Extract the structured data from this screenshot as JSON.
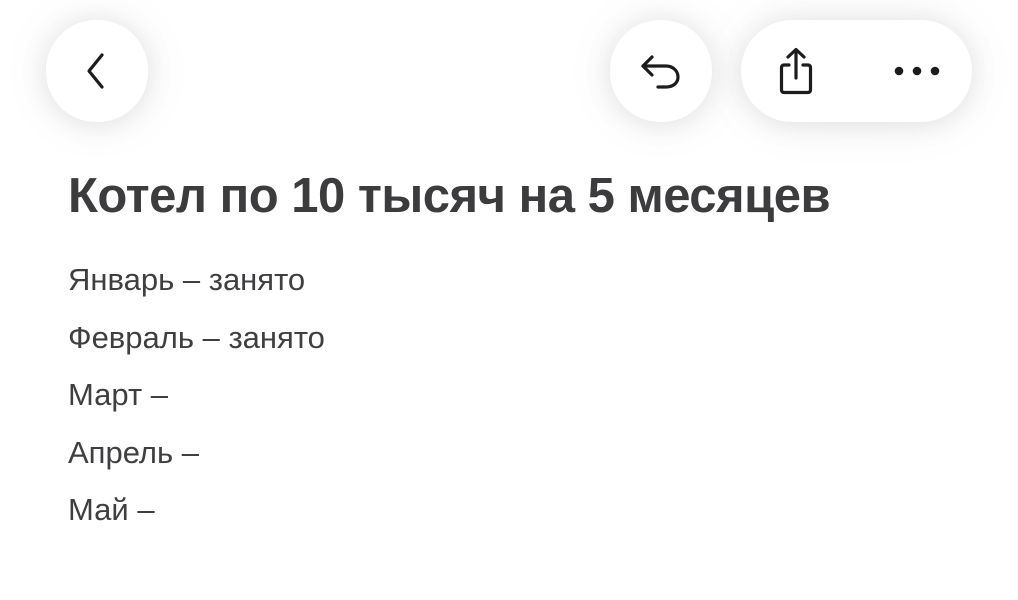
{
  "toolbar": {
    "back_icon": "chevron-left-icon",
    "undo_icon": "undo-arrow-icon",
    "share_icon": "share-icon",
    "more_icon": "ellipsis-icon"
  },
  "note": {
    "title": "Котел по 10 тысяч на 5 месяцев",
    "lines": [
      "Январь – занято",
      "Февраль – занято",
      "Март –",
      "Апрель –",
      "Май –"
    ]
  },
  "colors": {
    "text": "#3f3f42",
    "icon": "#1c1c1e",
    "background": "#ffffff"
  }
}
